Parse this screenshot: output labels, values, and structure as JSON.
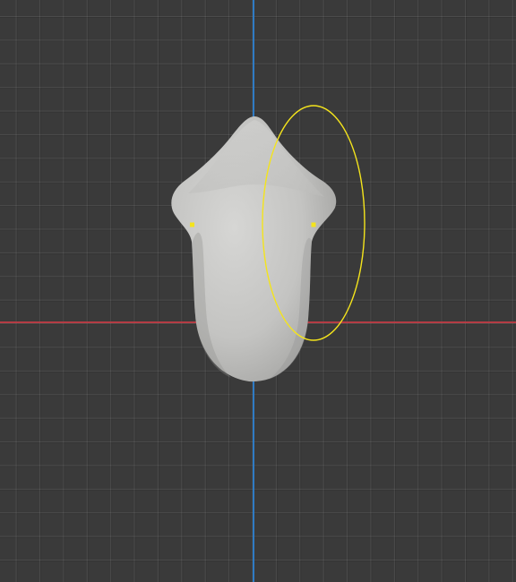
{
  "viewport": {
    "background": "#3a3a3a",
    "grid": "on"
  },
  "axes": {
    "x_axis_color": "#b43c44",
    "z_axis_color": "#2f7bc4"
  },
  "object": {
    "shading": "solid",
    "color": "#c8c8c6"
  },
  "selection": {
    "color": "#f4e41c",
    "tool": "ellipse-selection"
  }
}
